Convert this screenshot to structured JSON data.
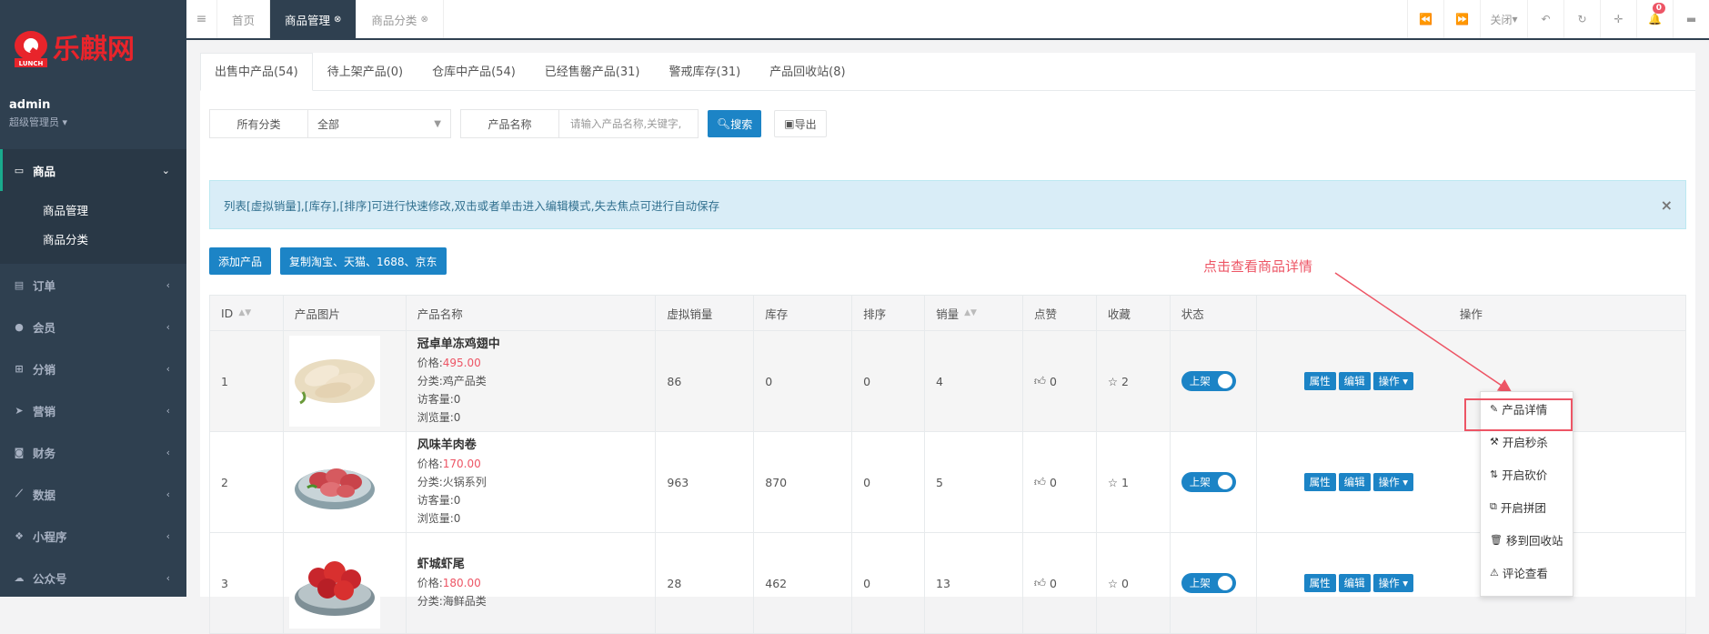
{
  "sidebar": {
    "logo_text": "乐麒网",
    "logo_sub": "LUNCH",
    "user_name": "admin",
    "user_role": "超级管理员 ▾",
    "menu": [
      {
        "label": "商品",
        "icon": "monitor-icon",
        "active": true
      },
      {
        "label": "订单",
        "icon": "file-icon"
      },
      {
        "label": "会员",
        "icon": "user-icon"
      },
      {
        "label": "分销",
        "icon": "sitemap-icon"
      },
      {
        "label": "营销",
        "icon": "paper-plane-icon"
      },
      {
        "label": "财务",
        "icon": "money-icon"
      },
      {
        "label": "数据",
        "icon": "line-chart-icon"
      },
      {
        "label": "小程序",
        "icon": "cubes-icon"
      },
      {
        "label": "公众号",
        "icon": "wechat-icon"
      }
    ],
    "submenu": [
      "商品管理",
      "商品分类"
    ]
  },
  "topbar": {
    "tabs": [
      {
        "label": "首页",
        "active": false
      },
      {
        "label": "商品管理",
        "active": true
      },
      {
        "label": "商品分类",
        "active": false
      }
    ],
    "close_label": "关闭",
    "notification_count": "0"
  },
  "product_tabs": [
    "出售中产品(54)",
    "待上架产品(0)",
    "仓库中产品(54)",
    "已经售罄产品(31)",
    "警戒库存(31)",
    "产品回收站(8)"
  ],
  "filters": {
    "category_label": "所有分类",
    "category_value": "全部",
    "name_label": "产品名称",
    "name_placeholder": "请输入产品名称,关键字,",
    "search_label": "搜索",
    "export_label": "导出"
  },
  "alert": "列表[虚拟销量],[库存],[排序]可进行快速修改,双击或者单击进入编辑模式,失去焦点可进行自动保存",
  "actions": {
    "add": "添加产品",
    "copy": "复制淘宝、天猫、1688、京东"
  },
  "annotation": "点击查看商品详情",
  "table": {
    "headers": [
      "ID",
      "产品图片",
      "产品名称",
      "虚拟销量",
      "库存",
      "排序",
      "销量",
      "点赞",
      "收藏",
      "状态",
      "操作"
    ],
    "rows": [
      {
        "id": "1",
        "name": "冠卓单冻鸡翅中",
        "price_label": "价格:",
        "price": "495.00",
        "category": "分类:鸡产品类",
        "visitors": "访客量:0",
        "views": "浏览量:0",
        "virtual_sales": "86",
        "stock": "0",
        "sort": "0",
        "sales": "4",
        "likes": "0",
        "favs": "2",
        "status": "上架",
        "image": "chicken-wings"
      },
      {
        "id": "2",
        "name": "风味羊肉卷",
        "price_label": "价格:",
        "price": "170.00",
        "category": "分类:火锅系列",
        "visitors": "访客量:0",
        "views": "浏览量:0",
        "virtual_sales": "963",
        "stock": "870",
        "sort": "0",
        "sales": "5",
        "likes": "0",
        "favs": "1",
        "status": "上架",
        "image": "lamb-rolls"
      },
      {
        "id": "3",
        "name": "虾城虾尾",
        "price_label": "价格:",
        "price": "180.00",
        "category": "分类:海鲜品类",
        "visitors": "",
        "views": "",
        "virtual_sales": "28",
        "stock": "462",
        "sort": "0",
        "sales": "13",
        "likes": "0",
        "favs": "0",
        "status": "上架",
        "image": "shrimp-tails"
      }
    ],
    "op_buttons": {
      "attr": "属性",
      "edit": "编辑",
      "ops": "操作 ▾"
    }
  },
  "dropdown": [
    "产品详情",
    "开启秒杀",
    "开启砍价",
    "开启拼团",
    "移到回收站",
    "评论查看"
  ],
  "colors": {
    "sidebar": "#2f4050",
    "primary": "#1c84c6",
    "danger": "#ed5565"
  }
}
